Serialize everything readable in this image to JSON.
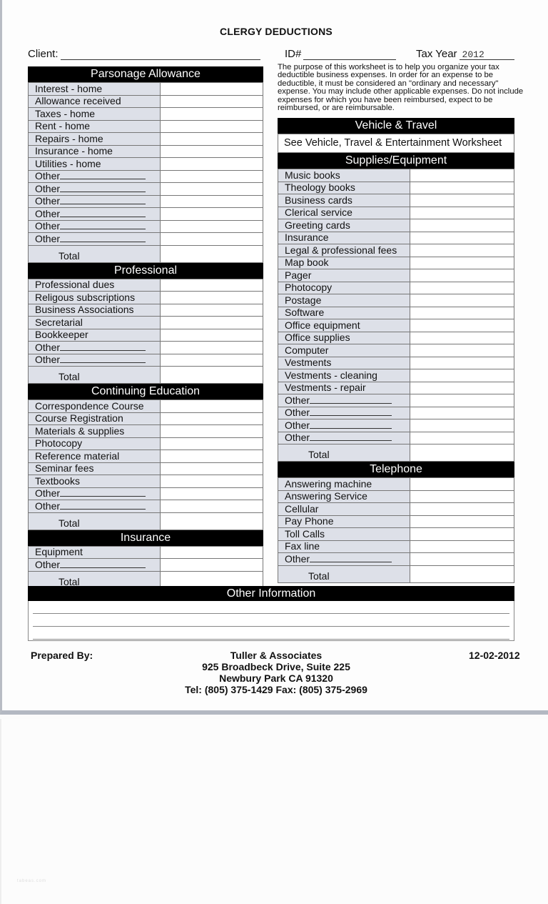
{
  "title": "CLERGY DEDUCTIONS",
  "header": {
    "client_label": "Client:",
    "client_value": "",
    "id_label": "ID#",
    "id_value": "",
    "tax_year_label": "Tax Year",
    "tax_year_value": "2012"
  },
  "intro": "The purpose of this worksheet is to help you organize your tax deductible business expenses.  In order for an expense to be deductible, it must be considered an \"ordinary and necessary\" expense.  You may include other applicable expenses.  Do not include expenses for which you have been reimbursed, expect to be reimbursed, or are reimbursable.",
  "total_label": "Total",
  "left_sections": [
    {
      "title": "Parsonage Allowance",
      "items": [
        "Interest - home",
        "Allowance received",
        "Taxes - home",
        "Rent - home",
        "Repairs - home",
        "Insurance - home",
        "Utilities - home",
        "Other",
        "Other",
        "Other",
        "Other",
        "Other",
        "Other"
      ]
    },
    {
      "title": "Professional",
      "items": [
        "Professional dues",
        "Religous subscriptions",
        "Business Associations",
        "Secretarial",
        "Bookkeeper",
        "Other",
        "Other"
      ]
    },
    {
      "title": "Continuing Education",
      "items": [
        "Correspondence Course",
        "Course Registration",
        "Materials & supplies",
        "Photocopy",
        "Reference material",
        "Seminar fees",
        "Textbooks",
        "Other",
        "Other"
      ]
    },
    {
      "title": "Insurance",
      "items": [
        "Equipment",
        "Other"
      ]
    }
  ],
  "vehicle": {
    "title": "Vehicle & Travel",
    "note": "See Vehicle, Travel & Entertainment Worksheet"
  },
  "right_sections": [
    {
      "title": "Supplies/Equipment",
      "items": [
        "Music books",
        "Theology books",
        "Business cards",
        "Clerical service",
        "Greeting cards",
        "Insurance",
        "Legal & professional fees",
        "Map book",
        "Pager",
        "Photocopy",
        "Postage",
        "Software",
        "Office equipment",
        "Office supplies",
        "Computer",
        "Vestments",
        "Vestments - cleaning",
        "Vestments - repair",
        "Other",
        "Other",
        "Other",
        "Other"
      ]
    },
    {
      "title": "Telephone",
      "items": [
        "Answering machine",
        "Answering Service",
        "Cellular",
        "Pay Phone",
        "Toll Calls",
        "Fax line",
        "Other"
      ]
    }
  ],
  "other_information": {
    "title": "Other Information",
    "lines": [
      "",
      "",
      ""
    ]
  },
  "footer": {
    "prepared_by_label": "Prepared By:",
    "company": "Tuller &  Associates",
    "address1": "925 Broadbeck Drive, Suite 225",
    "address2": "Newbury Park CA 91320",
    "phones": "Tel: (805) 375-1429   Fax: (805) 375-2969",
    "date": "12-02-2012"
  },
  "watermark": "tabeas.com"
}
